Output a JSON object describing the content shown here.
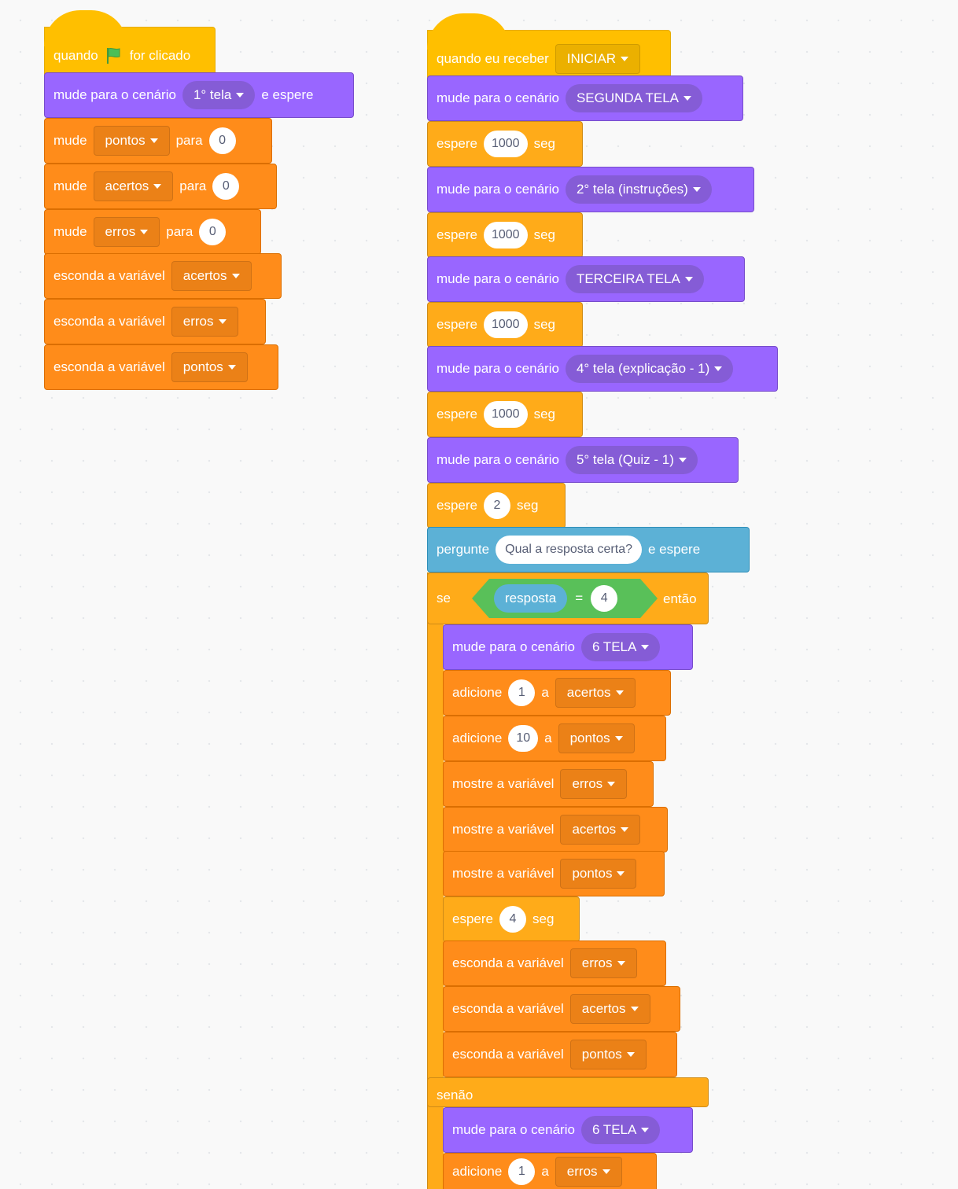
{
  "colors": {
    "events": "#ffbf00",
    "looks": "#9966ff",
    "variables": "#ff8c1a",
    "control": "#ffab19",
    "sensing": "#5cb1d6",
    "operators": "#59c059"
  },
  "left_script": {
    "hat": {
      "before": "quando",
      "icon": "green-flag-icon",
      "after": "for clicado"
    },
    "backdrop": {
      "label": "mude para o cenário",
      "value": "1° tela",
      "suffix": "e espere"
    },
    "set1": {
      "label": "mude",
      "var": "pontos",
      "to": "para",
      "value": "0"
    },
    "set2": {
      "label": "mude",
      "var": "acertos",
      "to": "para",
      "value": "0"
    },
    "set3": {
      "label": "mude",
      "var": "erros",
      "to": "para",
      "value": "0"
    },
    "hide1": {
      "label": "esconda a variável",
      "var": "acertos"
    },
    "hide2": {
      "label": "esconda a variável",
      "var": "erros"
    },
    "hide3": {
      "label": "esconda a variável",
      "var": "pontos"
    }
  },
  "right_script": {
    "hat": {
      "label": "quando eu receber",
      "value": "INICIAR"
    },
    "b1": {
      "label": "mude para o cenário",
      "value": "SEGUNDA TELA"
    },
    "w1": {
      "label": "espere",
      "value": "1000",
      "unit": "seg"
    },
    "b2": {
      "label": "mude para o cenário",
      "value": "2° tela (instruções)"
    },
    "w2": {
      "label": "espere",
      "value": "1000",
      "unit": "seg"
    },
    "b3": {
      "label": "mude para o cenário",
      "value": "TERCEIRA TELA"
    },
    "w3": {
      "label": "espere",
      "value": "1000",
      "unit": "seg"
    },
    "b4": {
      "label": "mude para o cenário",
      "value": "4° tela (explicação - 1)"
    },
    "w4": {
      "label": "espere",
      "value": "1000",
      "unit": "seg"
    },
    "b5": {
      "label": "mude para o cenário",
      "value": "5° tela (Quiz - 1)"
    },
    "w5": {
      "label": "espere",
      "value": "2",
      "unit": "seg"
    },
    "ask": {
      "label": "pergunte",
      "question": "Qual a resposta certa?",
      "suffix": "e espere"
    },
    "if": {
      "label": "se",
      "reporter": "resposta",
      "op": "=",
      "value": "4",
      "then": "então"
    },
    "then": {
      "b6": {
        "label": "mude para o cenário",
        "value": "6 TELA"
      },
      "add1": {
        "label": "adicione",
        "value": "1",
        "to": "a",
        "var": "acertos"
      },
      "add2": {
        "label": "adicione",
        "value": "10",
        "to": "a",
        "var": "pontos"
      },
      "show1": {
        "label": "mostre a variável",
        "var": "erros"
      },
      "show2": {
        "label": "mostre a variável",
        "var": "acertos"
      },
      "show3": {
        "label": "mostre a variável",
        "var": "pontos"
      },
      "w6": {
        "label": "espere",
        "value": "4",
        "unit": "seg"
      },
      "hide1": {
        "label": "esconda a variável",
        "var": "erros"
      },
      "hide2": {
        "label": "esconda a variável",
        "var": "acertos"
      },
      "hide3": {
        "label": "esconda a variável",
        "var": "pontos"
      }
    },
    "else_label": "senão",
    "else": {
      "b7": {
        "label": "mude para o cenário",
        "value": "6 TELA"
      },
      "add3": {
        "label": "adicione",
        "value": "1",
        "to": "a",
        "var": "erros"
      }
    }
  }
}
